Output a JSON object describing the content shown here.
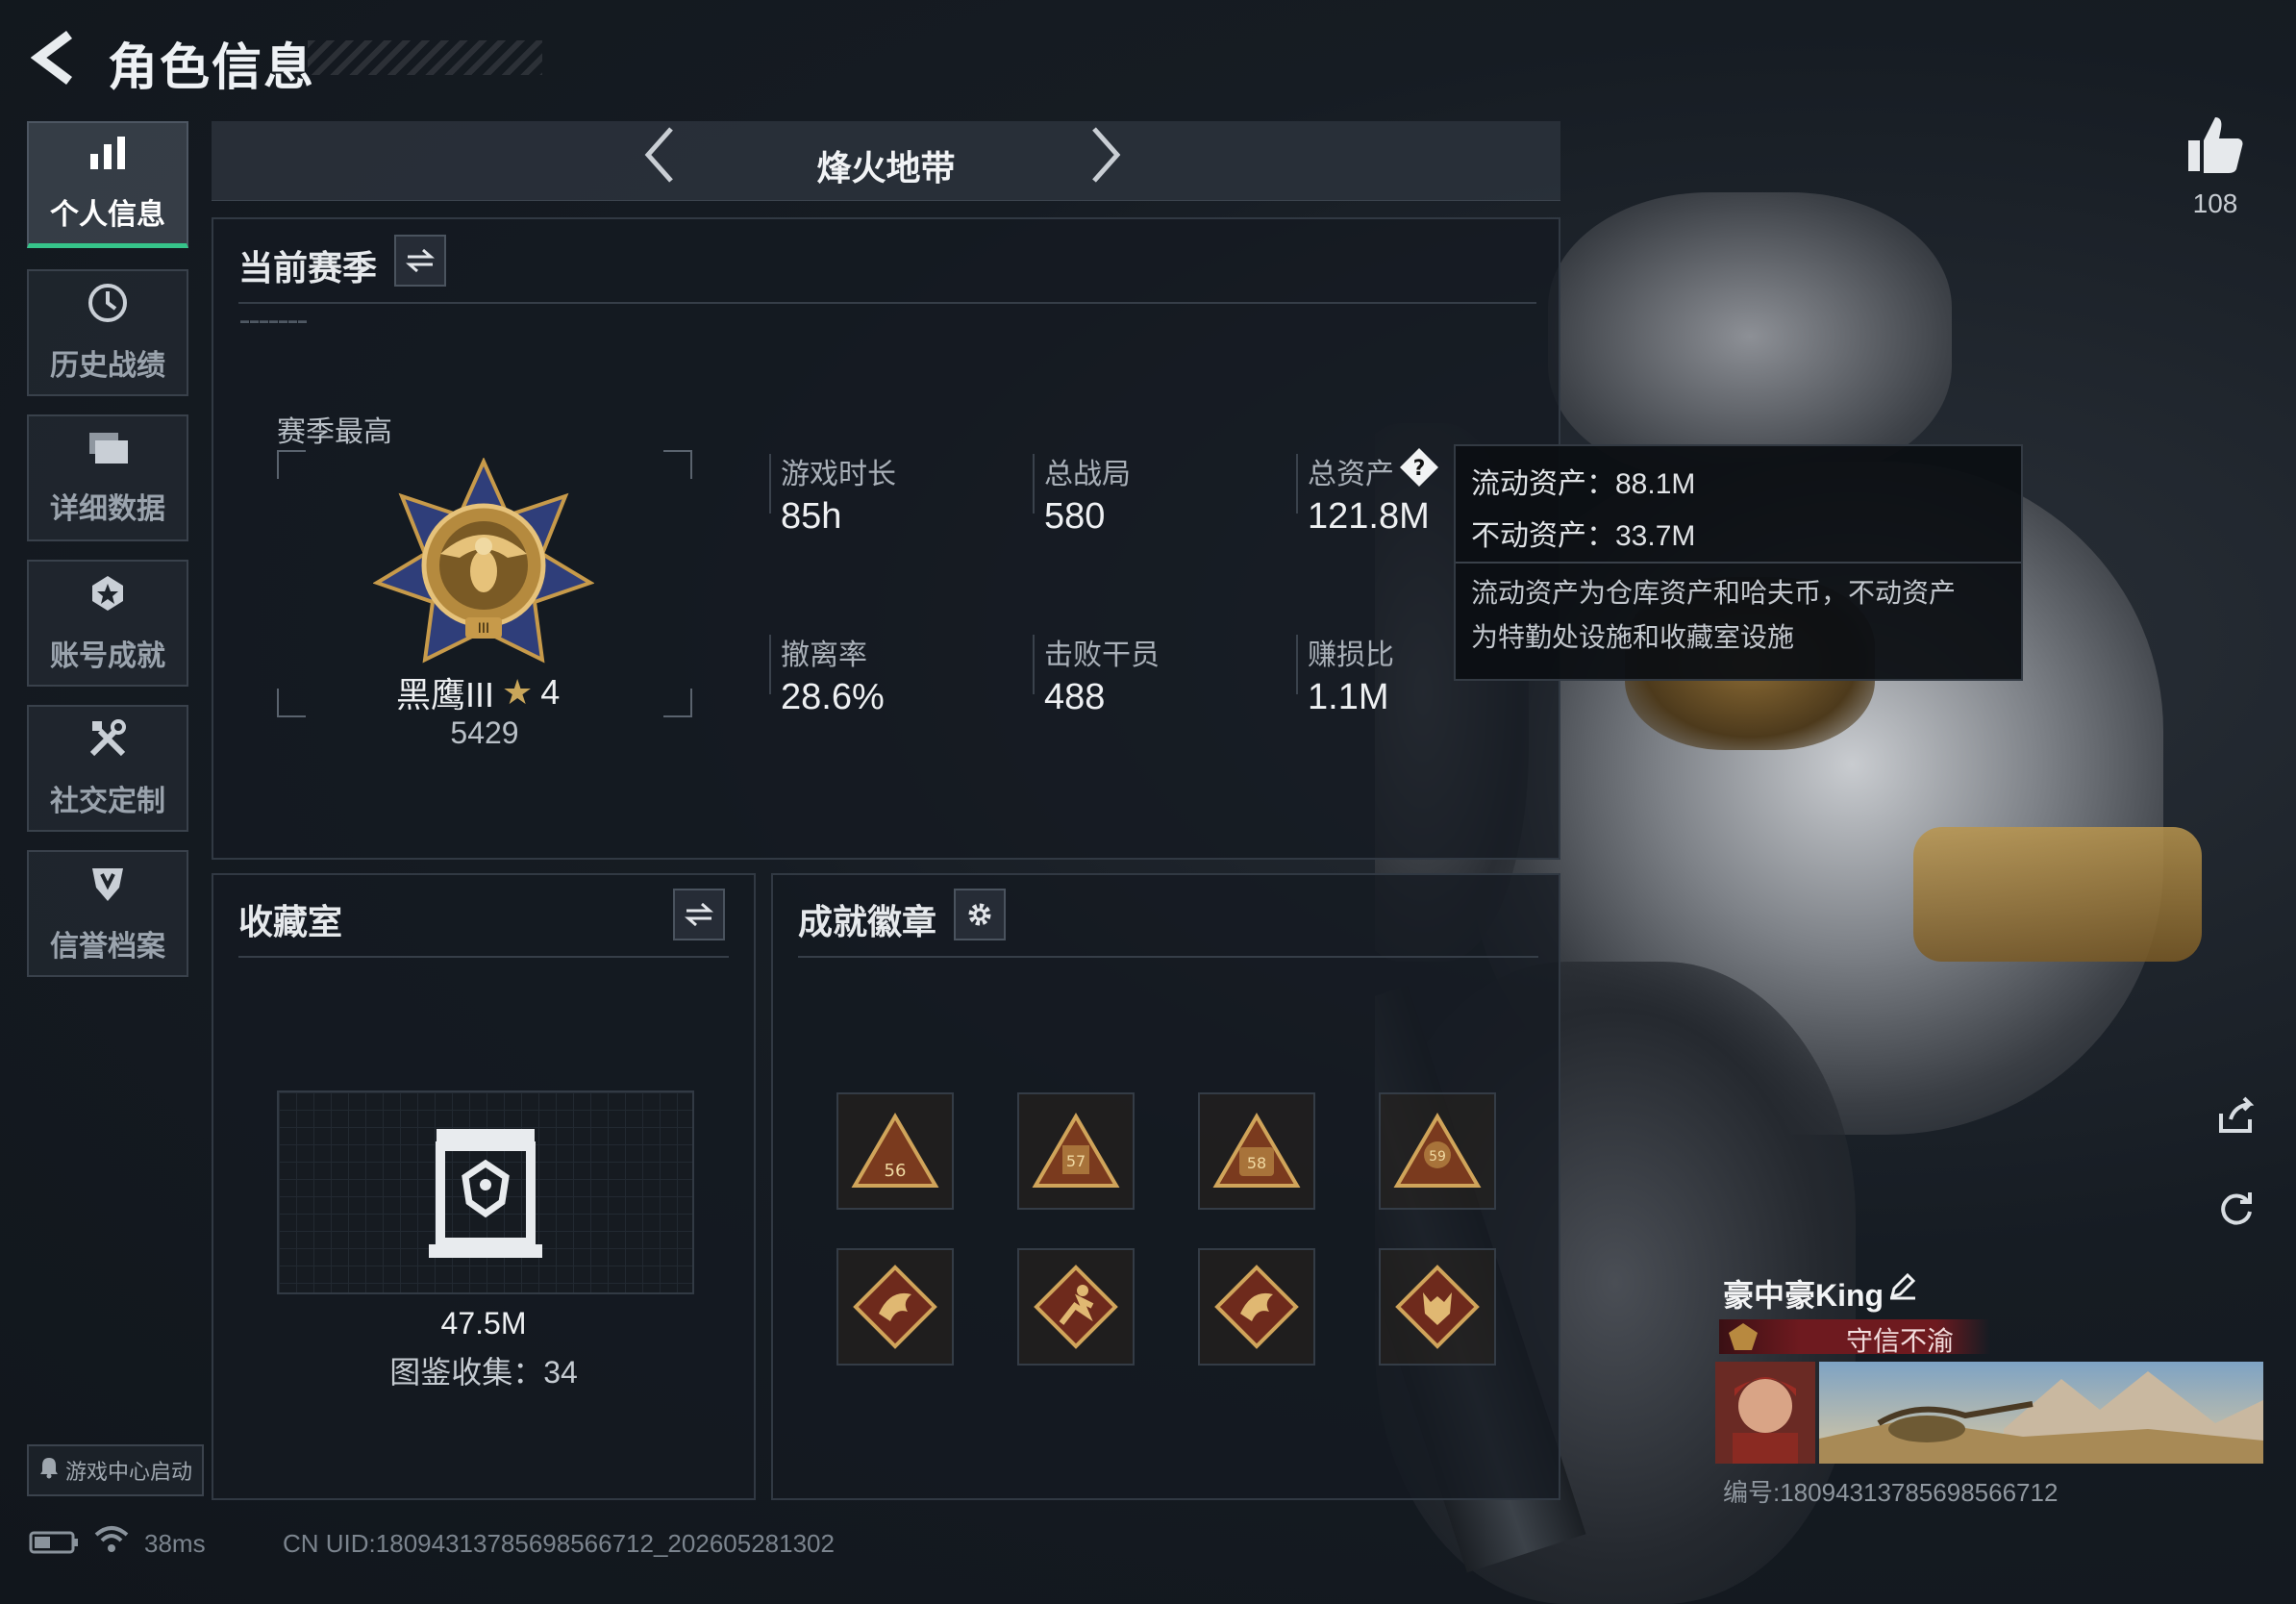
{
  "header": {
    "title": "角色信息"
  },
  "sidebar": {
    "items": [
      {
        "label": "个人信息",
        "icon": "bar-chart-icon",
        "active": true
      },
      {
        "label": "历史战绩",
        "icon": "history-clock-icon",
        "active": false
      },
      {
        "label": "详细数据",
        "icon": "folder-icon",
        "active": false
      },
      {
        "label": "账号成就",
        "icon": "medal-star-icon",
        "active": false
      },
      {
        "label": "社交定制",
        "icon": "tools-icon",
        "active": false
      },
      {
        "label": "信誉档案",
        "icon": "shield-badge-icon",
        "active": false
      }
    ]
  },
  "mode": {
    "name": "烽火地带"
  },
  "season": {
    "title": "当前赛季",
    "best_label": "赛季最高",
    "rank_name": "黑鹰III",
    "rank_stars": "4",
    "rank_points": "5429",
    "stats": [
      {
        "label": "游戏时长",
        "value": "85h"
      },
      {
        "label": "总战局",
        "value": "580"
      },
      {
        "label": "总资产",
        "value": "121.8M"
      },
      {
        "label": "撤离率",
        "value": "28.6%"
      },
      {
        "label": "击败干员",
        "value": "488"
      },
      {
        "label": "赚损比",
        "value": "1.1M"
      }
    ]
  },
  "tooltip": {
    "liquid": "流动资产：88.1M",
    "fixed": "不动资产：33.7M",
    "note_line1": "流动资产为仓库资产和哈夫币，不动资产",
    "note_line2": "为特勤处设施和收藏室设施"
  },
  "collection": {
    "title": "收藏室",
    "value": "47.5M",
    "catalog": "图鉴收集：34"
  },
  "achievements": {
    "title": "成就徽章",
    "badges": [
      "56",
      "57",
      "58",
      "59",
      "dragon",
      "runner",
      "dragon",
      "wolf"
    ]
  },
  "profile": {
    "likes": "108",
    "player_name": "豪中豪King",
    "title": "守信不渝",
    "player_id": "编号:1809431378569856671​2"
  },
  "footer": {
    "game_center": "游戏中心启动",
    "ping": "38ms",
    "uid": "CN UID:1809431378569856671​2_202605281302"
  },
  "colors": {
    "accent_green": "#36c48a",
    "gold": "#c79a4a",
    "title_red": "#6e1a1f"
  }
}
